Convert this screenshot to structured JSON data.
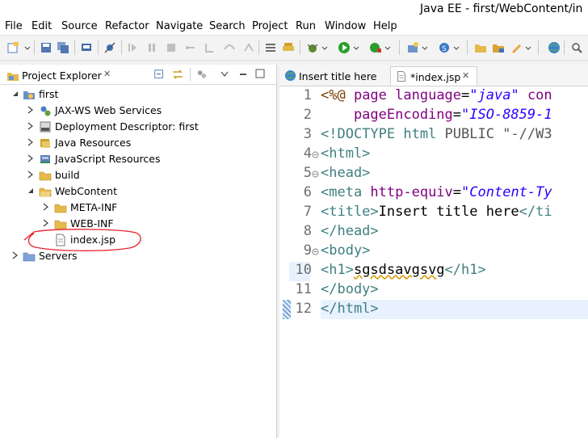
{
  "window": {
    "title": "Java EE - first/WebContent/in"
  },
  "menu": [
    "File",
    "Edit",
    "Source",
    "Refactor",
    "Navigate",
    "Search",
    "Project",
    "Run",
    "Window",
    "Help"
  ],
  "project_explorer": {
    "title": "Project Explorer",
    "close_glyph": "✕",
    "tree": [
      {
        "label": "first"
      },
      {
        "label": "JAX-WS Web Services"
      },
      {
        "label": "Deployment Descriptor: first"
      },
      {
        "label": "Java Resources"
      },
      {
        "label": "JavaScript Resources"
      },
      {
        "label": "build"
      },
      {
        "label": "WebContent"
      },
      {
        "label": "META-INF"
      },
      {
        "label": "WEB-INF"
      },
      {
        "label": "index.jsp"
      },
      {
        "label": "Servers"
      }
    ]
  },
  "editor": {
    "tabs": [
      {
        "label": "Insert title here"
      },
      {
        "label": "*index.jsp"
      }
    ],
    "close_glyph": "✕",
    "line_numbers": [
      "1",
      "2",
      "3",
      "4",
      "5",
      "6",
      "7",
      "8",
      "9",
      "10",
      "11",
      "12"
    ],
    "lines": {
      "l1a": "<%@",
      "l1b": " page ",
      "l1c": "language",
      "l1d": "=",
      "l1e": "\"java\"",
      "l1f": " con",
      "l2a": "    pageEncoding",
      "l2b": "=",
      "l2c": "\"ISO-8859-1",
      "l3a": "<!DOCTYPE html ",
      "l3b": "PUBLIC ",
      "l3c": "\"-//W3",
      "l4": "<html>",
      "l5": "<head>",
      "l6a": "<meta ",
      "l6b": "http-equiv",
      "l6c": "=",
      "l6d": "\"Content-Ty",
      "l7a": "<title>",
      "l7b": "Insert title here",
      "l7c": "</ti",
      "l8": "</head>",
      "l9": "<body>",
      "l10a": "<h1>",
      "l10b": "sgsdsavgsvg",
      "l10c": "</h1>",
      "l11": "</body>",
      "l12": "</html>"
    }
  },
  "colors": {
    "annotation": "#e8212b",
    "current_line": "#e8f2fe"
  }
}
